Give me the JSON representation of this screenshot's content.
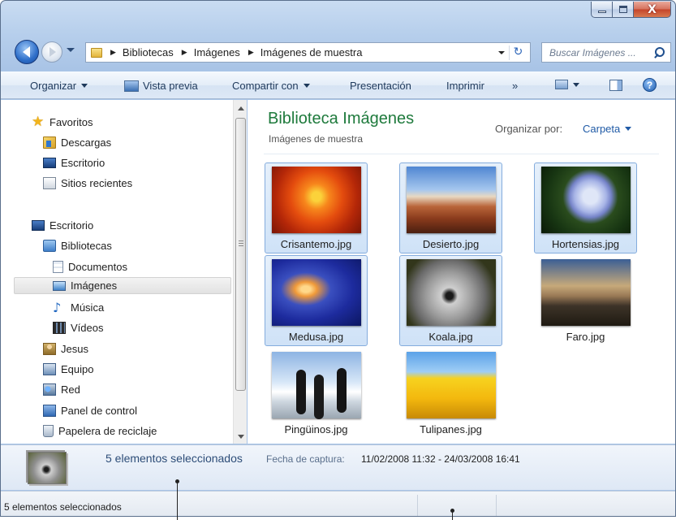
{
  "window": {
    "title_buttons": [
      "minimize",
      "maximize",
      "close"
    ],
    "close_glyph": "X"
  },
  "nav": {
    "breadcrumb": [
      "Bibliotecas",
      "Imágenes",
      "Imágenes de muestra"
    ],
    "search_placeholder": "Buscar Imágenes ..."
  },
  "toolbar": {
    "organize": "Organizar",
    "preview": "Vista previa",
    "share": "Compartir con",
    "slideshow": "Presentación",
    "print": "Imprimir",
    "more": "»",
    "help": "?"
  },
  "sidebar": {
    "items": [
      {
        "label": "Favoritos",
        "icon": "star-icon"
      },
      {
        "label": "Descargas",
        "icon": "downloads-folder-icon"
      },
      {
        "label": "Escritorio",
        "icon": "desktop-icon"
      },
      {
        "label": "Sitios recientes",
        "icon": "recent-places-icon"
      },
      {
        "label": "Escritorio",
        "icon": "desktop-icon"
      },
      {
        "label": "Bibliotecas",
        "icon": "libraries-icon"
      },
      {
        "label": "Documentos",
        "icon": "documents-icon"
      },
      {
        "label": "Imágenes",
        "icon": "pictures-icon",
        "selected": true
      },
      {
        "label": "Música",
        "icon": "music-icon"
      },
      {
        "label": "Vídeos",
        "icon": "videos-icon"
      },
      {
        "label": "Jesus",
        "icon": "user-folder-icon"
      },
      {
        "label": "Equipo",
        "icon": "computer-icon"
      },
      {
        "label": "Red",
        "icon": "network-icon"
      },
      {
        "label": "Panel de control",
        "icon": "control-panel-icon"
      },
      {
        "label": "Papelera de reciclaje",
        "icon": "recycle-bin-icon"
      }
    ]
  },
  "content": {
    "title": "Biblioteca Imágenes",
    "subtitle": "Imágenes de muestra",
    "arrange_label": "Organizar por:",
    "arrange_value": "Carpeta",
    "files": [
      {
        "name": "Crisantemo.jpg",
        "selected": true
      },
      {
        "name": "Desierto.jpg",
        "selected": true
      },
      {
        "name": "Hortensias.jpg",
        "selected": true
      },
      {
        "name": "Medusa.jpg",
        "selected": true
      },
      {
        "name": "Koala.jpg",
        "selected": true
      },
      {
        "name": "Faro.jpg",
        "selected": false
      },
      {
        "name": "Pingüinos.jpg",
        "selected": false
      },
      {
        "name": "Tulipanes.jpg",
        "selected": false
      }
    ]
  },
  "details": {
    "selection": "5 elementos seleccionados",
    "date_label": "Fecha de captura:",
    "date_value": "11/02/2008 11:32 - 24/03/2008 16:41"
  },
  "status": {
    "text": "5 elementos seleccionados"
  },
  "colors": {
    "title_green": "#1e7a3c",
    "link_blue": "#1f5aa6",
    "selection_border": "#84acdd"
  }
}
